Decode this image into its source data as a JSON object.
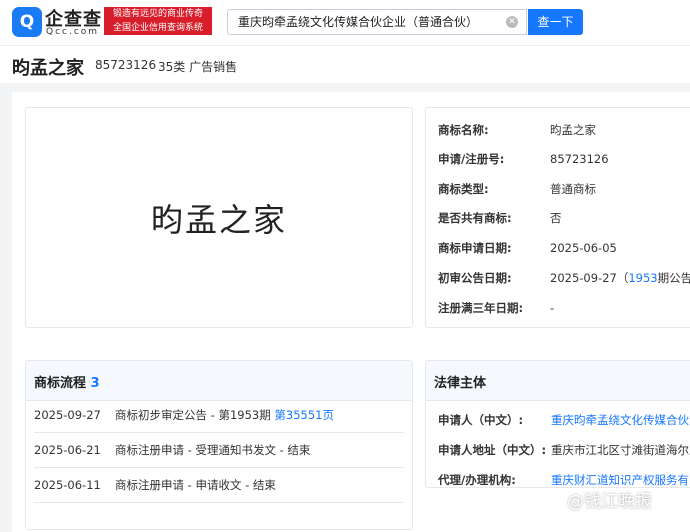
{
  "header": {
    "logo_icon": "Q",
    "logo_name": "企查查",
    "logo_sub": "Qcc.com",
    "slogan": [
      "锻造有远见的商业传奇",
      "全国企业信用查询系统"
    ],
    "search_value": "重庆昀牵孟绕文化传媒合伙企业（普通合伙）",
    "search_button": "查一下"
  },
  "title": {
    "name": "昀孟之家",
    "number": "85723126",
    "class": "35类 广告销售"
  },
  "trademark_image_text": "昀孟之家",
  "info": [
    {
      "label": "商标名称:",
      "value": "昀孟之家"
    },
    {
      "label": "申请/注册号:",
      "value": "85723126"
    },
    {
      "label": "商标类型:",
      "value": "普通商标"
    },
    {
      "label": "是否共有商标:",
      "value": "否"
    },
    {
      "label": "商标申请日期:",
      "value": "2025-06-05"
    },
    {
      "label": "初审公告日期:",
      "value": "2025-09-27（",
      "link": "1953",
      "suffix": "期公告）"
    },
    {
      "label": "注册满三年日期:",
      "value": "-"
    }
  ],
  "flow": {
    "title": "商标流程",
    "count": "3",
    "rows": [
      {
        "date": "2025-09-27",
        "text": "商标初步审定公告 - 第1953期",
        "link": "第35551页"
      },
      {
        "date": "2025-06-21",
        "text": "商标注册申请 - 受理通知书发文 - 结束"
      },
      {
        "date": "2025-06-11",
        "text": "商标注册申请 - 申请收文 - 结束"
      }
    ]
  },
  "legal": {
    "title": "法律主体",
    "rows": [
      {
        "label": "申请人（中文）:",
        "value": "重庆昀牵孟绕文化传媒合伙企业"
      },
      {
        "label": "申请人地址（中文）:",
        "value": "重庆市江北区寸滩街道海尔路"
      },
      {
        "label": "代理/办理机构:",
        "value": "重庆财汇道知识产权服务有限公司"
      }
    ]
  },
  "watermark": "@钱江晚报"
}
